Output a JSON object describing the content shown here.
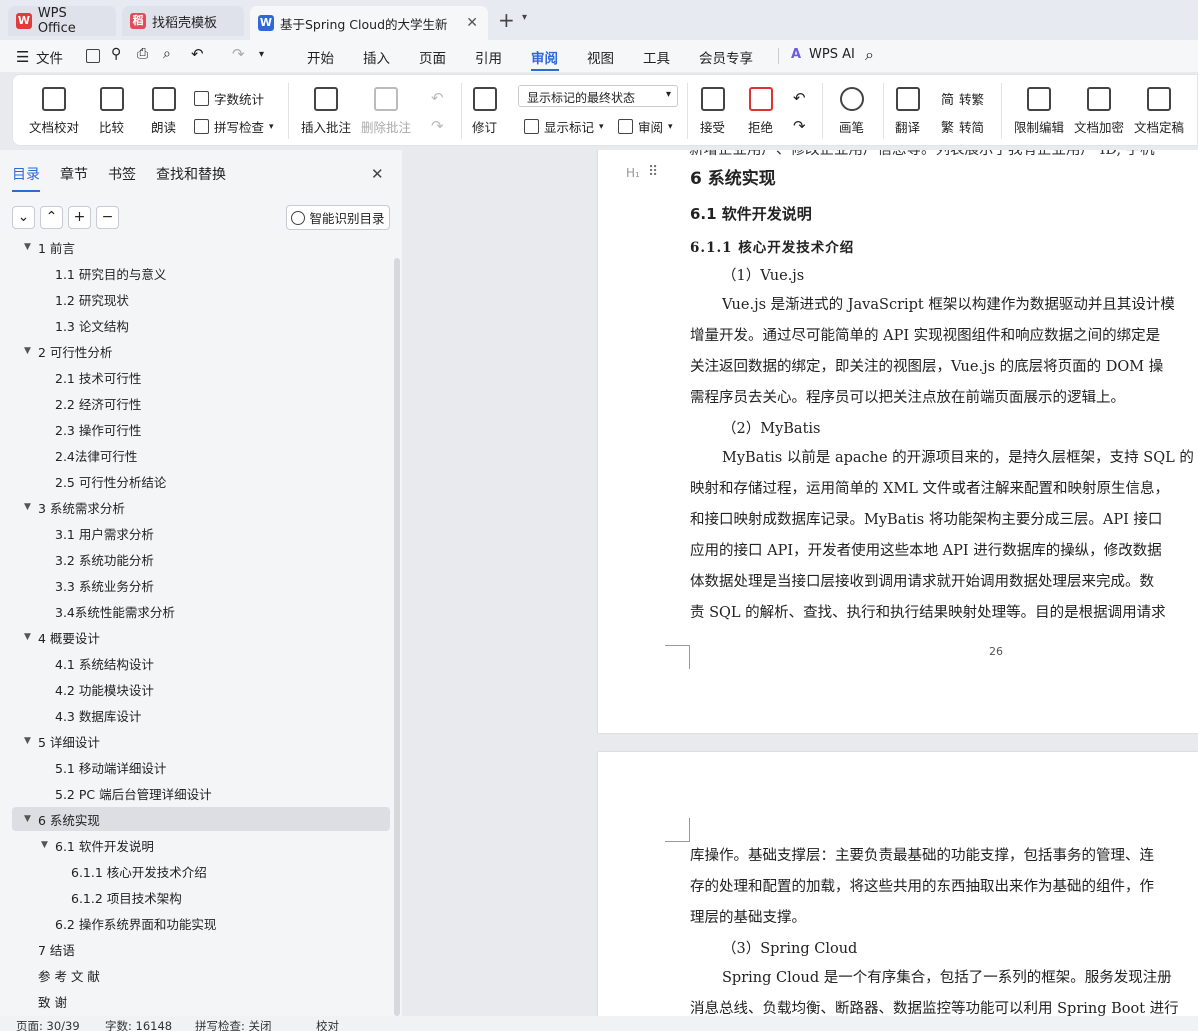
{
  "tabs": [
    {
      "label": "WPS Office",
      "active": false
    },
    {
      "label": "找稻壳模板",
      "active": false
    },
    {
      "label": "基于Spring Cloud的大学生新",
      "active": true
    }
  ],
  "menubar": {
    "file": "文件",
    "items": [
      "开始",
      "插入",
      "页面",
      "引用",
      "审阅",
      "视图",
      "工具",
      "会员专享"
    ],
    "active": "审阅",
    "ai": "WPS AI"
  },
  "ribbon": {
    "doc_check": "文档校对",
    "compare": "比较",
    "read": "朗读",
    "word_count": "字数统计",
    "spell_check": "拼写检查",
    "insert_comment": "插入批注",
    "delete_comment": "删除批注",
    "revise": "修订",
    "markup_state": "显示标记的最终状态",
    "show_markup": "显示标记",
    "review": "审阅",
    "accept": "接受",
    "reject": "拒绝",
    "pen": "画笔",
    "translate": "翻译",
    "to_trad": "转繁",
    "to_simp": "转简",
    "restrict": "限制编辑",
    "encrypt": "文档加密",
    "finalize": "文档定稿"
  },
  "sidebar": {
    "tabs": [
      "目录",
      "章节",
      "书签",
      "查找和替换"
    ],
    "smart_btn": "智能识别目录",
    "toc": [
      {
        "text": "1   前言",
        "level": 0,
        "arrow": true
      },
      {
        "text": "1.1   研究目的与意义",
        "level": 1
      },
      {
        "text": "1.2   研究现状",
        "level": 1
      },
      {
        "text": "1.3   论文结构",
        "level": 1
      },
      {
        "text": "2   可行性分析",
        "level": 0,
        "arrow": true
      },
      {
        "text": "2.1   技术可行性",
        "level": 1
      },
      {
        "text": "2.2   经济可行性",
        "level": 1
      },
      {
        "text": "2.3   操作可行性",
        "level": 1
      },
      {
        "text": "2.4法律可行性",
        "level": 1
      },
      {
        "text": "2.5   可行性分析结论",
        "level": 1
      },
      {
        "text": "3   系统需求分析",
        "level": 0,
        "arrow": true
      },
      {
        "text": "3.1   用户需求分析",
        "level": 1
      },
      {
        "text": "3.2   系统功能分析",
        "level": 1
      },
      {
        "text": "3.3   系统业务分析",
        "level": 1
      },
      {
        "text": "3.4系统性能需求分析",
        "level": 1
      },
      {
        "text": "4   概要设计",
        "level": 0,
        "arrow": true
      },
      {
        "text": "4.1   系统结构设计",
        "level": 1
      },
      {
        "text": "4.2   功能模块设计",
        "level": 1
      },
      {
        "text": "4.3   数据库设计",
        "level": 1
      },
      {
        "text": "5   详细设计",
        "level": 0,
        "arrow": true
      },
      {
        "text": "5.1   移动端详细设计",
        "level": 1
      },
      {
        "text": "5.2   PC 端后台管理详细设计",
        "level": 1
      },
      {
        "text": "6   系统实现",
        "level": 0,
        "arrow": true,
        "selected": true
      },
      {
        "text": "6.1   软件开发说明",
        "level": 1,
        "arrow": true
      },
      {
        "text": "6.1.1   核心开发技术介绍",
        "level": 2
      },
      {
        "text": "6.1.2   项目技术架构",
        "level": 2
      },
      {
        "text": "6.2   操作系统界面和功能实现",
        "level": 1
      },
      {
        "text": "7   结语",
        "level": 0
      },
      {
        "text": "参   考   文   献",
        "level": 0
      },
      {
        "text": "致          谢",
        "level": 0
      }
    ]
  },
  "document": {
    "top_cut": "新增企业用户、修改企业用户信息等。列表展示了我有企业用户 ID, 手机",
    "h1": "6    系统实现",
    "h2": "6.1    软件开发说明",
    "h3": "6.1.1    核心开发技术介绍",
    "p1_title": "（1）Vue.js",
    "p1": [
      "Vue.js 是渐进式的 JavaScript 框架以构建作为数据驱动并且其设计模",
      "增量开发。通过尽可能简单的 API 实现视图组件和响应数据之间的绑定是",
      "关注返回数据的绑定，即关注的视图层，Vue.js 的底层将页面的 DOM 操",
      "需程序员去关心。程序员可以把关注点放在前端页面展示的逻辑上。"
    ],
    "p2_title": "（2）MyBatis",
    "p2": [
      "MyBatis 以前是 apache 的开源项目来的，是持久层框架，支持 SQL 的",
      "映射和存储过程，运用简单的 XML 文件或者注解来配置和映射原生信息，",
      "和接口映射成数据库记录。MyBatis 将功能架构主要分成三层。API 接口",
      "应用的接口 API，开发者使用这些本地 API 进行数据库的操纵，修改数据",
      "体数据处理是当接口层接收到调用请求就开始调用数据处理层来完成。数",
      "责 SQL 的解析、查找、执行和执行结果映射处理等。目的是根据调用请求"
    ],
    "page_number": "26",
    "page2": [
      "库操作。基础支撑层：主要负责最基础的功能支撑，包括事务的管理、连",
      "存的处理和配置的加载，将这些共用的东西抽取出来作为基础的组件，作",
      "理层的基础支撑。"
    ],
    "p3_title": "（3）Spring Cloud",
    "p3": [
      "Spring Cloud 是一个有序集合，包括了一系列的框架。服务发现注册",
      "消息总线、负载均衡、断路器、数据监控等功能可以利用 Spring Boot 进行"
    ]
  },
  "status": {
    "page": "页面: 30/39",
    "words": "字数: 16148",
    "spell": "拼写检查: 关闭",
    "proof": "校对"
  }
}
